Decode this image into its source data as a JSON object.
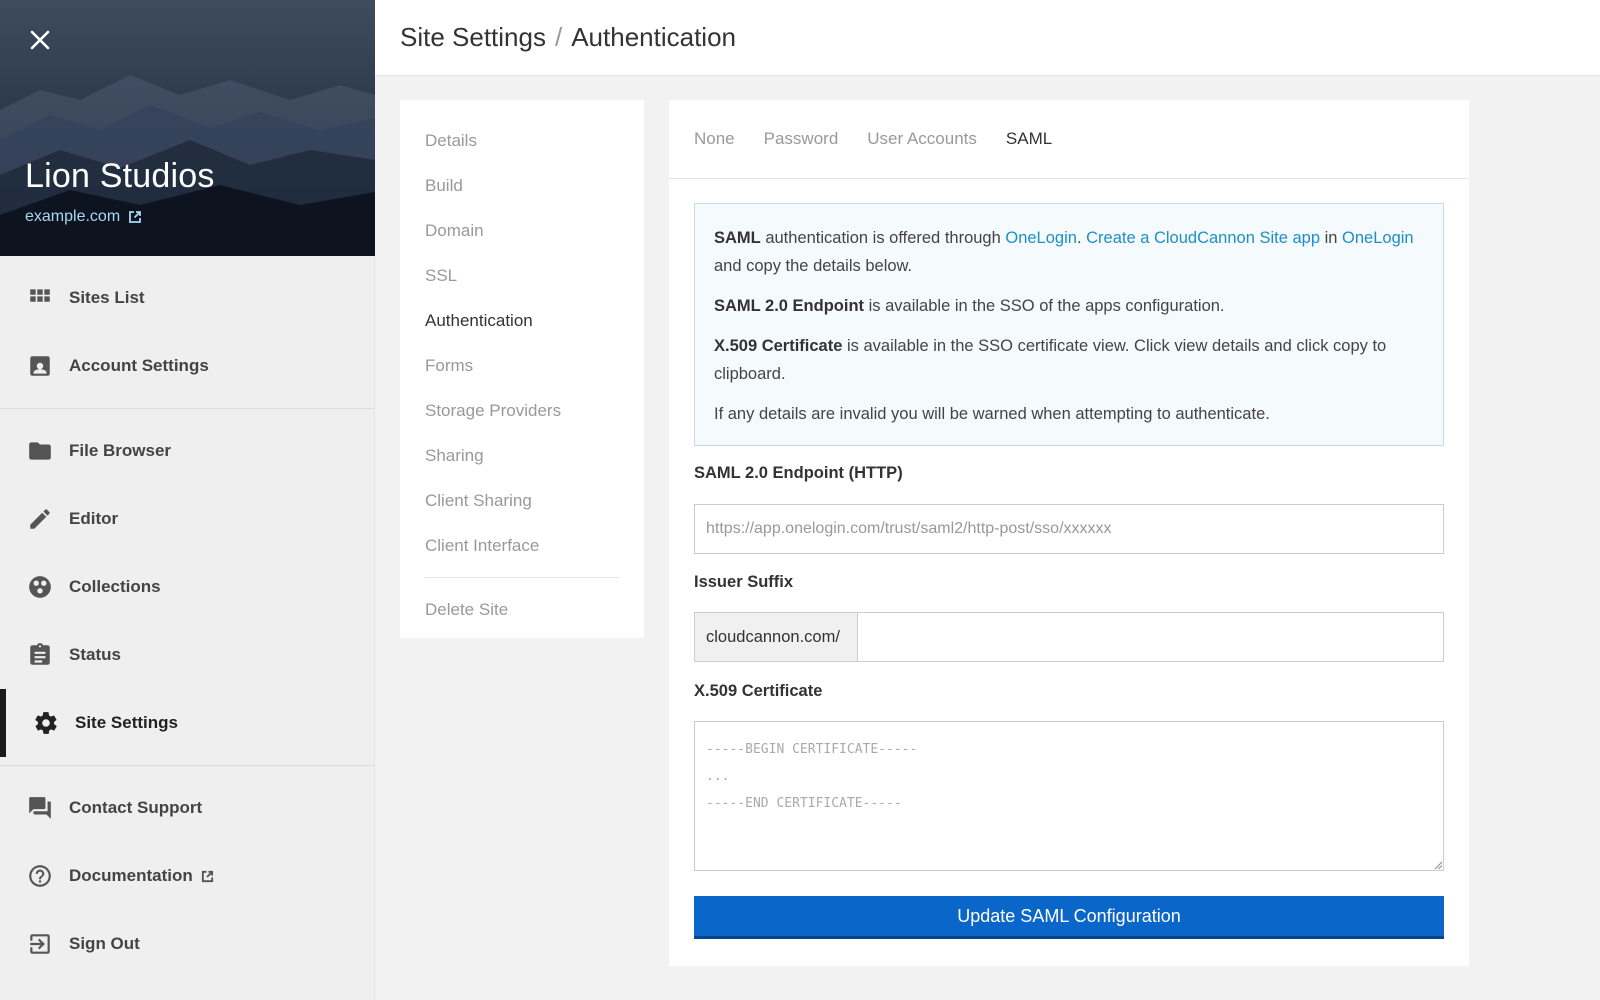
{
  "sidebar": {
    "site_name": "Lion Studios",
    "site_url": "example.com",
    "groups": [
      [
        {
          "label": "Sites List",
          "icon": "grid-icon"
        },
        {
          "label": "Account Settings",
          "icon": "account-box-icon"
        }
      ],
      [
        {
          "label": "File Browser",
          "icon": "folder-icon"
        },
        {
          "label": "Editor",
          "icon": "pencil-icon"
        },
        {
          "label": "Collections",
          "icon": "collections-icon"
        },
        {
          "label": "Status",
          "icon": "clipboard-icon"
        },
        {
          "label": "Site Settings",
          "icon": "gear-icon",
          "active": true
        }
      ],
      [
        {
          "label": "Contact Support",
          "icon": "chat-icon"
        },
        {
          "label": "Documentation",
          "icon": "help-circle-icon"
        },
        {
          "label": "Sign Out",
          "icon": "sign-out-icon"
        }
      ]
    ]
  },
  "header": {
    "section": "Site Settings",
    "separator": "/",
    "page": "Authentication"
  },
  "settings_menu": {
    "items": [
      "Details",
      "Build",
      "Domain",
      "SSL",
      "Authentication",
      "Forms",
      "Storage Providers",
      "Sharing",
      "Client Sharing",
      "Client Interface"
    ],
    "active": "Authentication",
    "danger_item": "Delete Site"
  },
  "tabs": {
    "items": [
      "None",
      "Password",
      "User Accounts",
      "SAML"
    ],
    "active": "SAML"
  },
  "info": {
    "p1_bold": "SAML",
    "p1_text1": " authentication is offered through ",
    "p1_link1": "OneLogin",
    "p1_text2": ". ",
    "p1_link2": "Create a CloudCannon Site app",
    "p1_text3": " in ",
    "p1_link3": "OneLogin",
    "p1_text4": " and copy the details below.",
    "p2_bold": "SAML 2.0 Endpoint",
    "p2_text": " is available in the SSO of the apps configuration.",
    "p3_bold": "X.509 Certificate",
    "p3_text": " is available in the SSO certificate view. Click view details and click copy to clipboard.",
    "p4_text": "If any details are invalid you will be warned when attempting to authenticate."
  },
  "form": {
    "endpoint_label": "SAML 2.0 Endpoint (HTTP)",
    "endpoint_placeholder": "https://app.onelogin.com/trust/saml2/http-post/sso/xxxxxx",
    "issuer_label": "Issuer Suffix",
    "issuer_prefix": "cloudcannon.com/",
    "cert_label": "X.509 Certificate",
    "cert_placeholder": "-----BEGIN CERTIFICATE-----\n...\n-----END CERTIFICATE-----",
    "submit_label": "Update SAML Configuration"
  },
  "colors": {
    "primary_button": "#0a66c8",
    "link": "#1e8fc6",
    "info_bg": "#f5fafd"
  }
}
